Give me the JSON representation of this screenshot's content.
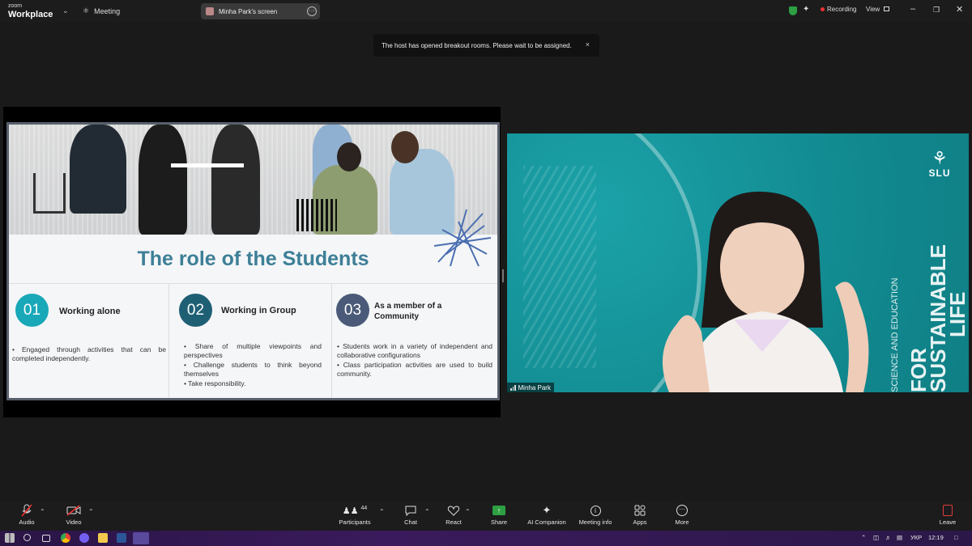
{
  "app": {
    "logo_small": "zoom",
    "logo_big": "Workplace",
    "meeting_label": "Meeting",
    "screen_share_label": "Minha Park's screen",
    "recording_label": "Recording",
    "view_label": "View"
  },
  "notification": {
    "text": "The host has opened breakout rooms. Please wait to be assigned.",
    "close": "×"
  },
  "slide": {
    "title": "The role of the Students",
    "columns": [
      {
        "number": "01",
        "heading": "Working alone",
        "bullets": [
          "• Engaged through activities that can be completed independently."
        ],
        "color": "#19a8b8"
      },
      {
        "number": "02",
        "heading": "Working in Group",
        "bullets": [
          "• Share of multiple viewpoints and perspectives",
          "• Challenge students to think beyond themselves",
          "• Take responsibility."
        ],
        "color": "#1f5f74"
      },
      {
        "number": "03",
        "heading": "As a member of a Community",
        "bullets": [
          "• Students work in a variety of independent and collaborative configurations",
          "• Class participation activities are used to build community."
        ],
        "color": "#4a5a78"
      }
    ]
  },
  "video": {
    "participant_name": "Minha Park",
    "logo_text": "SLU",
    "vertical_small": "SCIENCE AND EDUCATION",
    "vertical_big_1": "FOR",
    "vertical_big_2": "SUSTAINABLE",
    "vertical_big_3": "LIFE"
  },
  "toolbar": {
    "audio": "Audio",
    "video": "Video",
    "participants": "Participants",
    "participants_count": "44",
    "chat": "Chat",
    "react": "React",
    "share": "Share",
    "ai_companion": "AI Companion",
    "meeting_info": "Meeting info",
    "apps": "Apps",
    "more": "More",
    "leave": "Leave"
  },
  "taskbar": {
    "language": "УКР",
    "time": "12:19"
  },
  "colors": {
    "share_green": "#2ea043",
    "leave_red": "#e03b3b",
    "slide_title": "#3d7f97",
    "video_bg": "#14959b"
  }
}
